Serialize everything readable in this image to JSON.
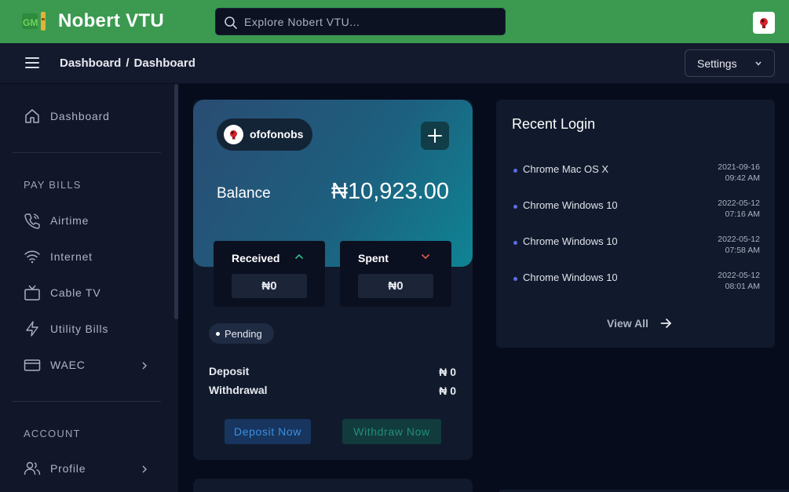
{
  "app": {
    "brand": "Nobert VTU"
  },
  "search": {
    "placeholder": "Explore Nobert VTU..."
  },
  "breadcrumb": {
    "parent": "Dashboard",
    "separator": "/",
    "current": "Dashboard"
  },
  "settings": {
    "label": "Settings"
  },
  "sidebar": {
    "dashboard": "Dashboard",
    "pay_bills_heading": "PAY BILLS",
    "items": [
      {
        "label": "Airtime",
        "icon": "phone-icon"
      },
      {
        "label": "Internet",
        "icon": "wifi-icon"
      },
      {
        "label": "Cable TV",
        "icon": "tv-icon"
      },
      {
        "label": "Utility Bills",
        "icon": "bolt-icon"
      },
      {
        "label": "WAEC",
        "icon": "card-icon"
      }
    ],
    "account_heading": "ACCOUNT",
    "profile": "Profile"
  },
  "wallet": {
    "username": "ofofonobs",
    "balance_label": "Balance",
    "balance_value": "₦10,923.00",
    "received_label": "Received",
    "received_value": "₦0",
    "spent_label": "Spent",
    "spent_value": "₦0",
    "status_badge": "Pending",
    "deposit_label": "Deposit",
    "deposit_value": "₦ 0",
    "withdrawal_label": "Withdrawal",
    "withdrawal_value": "₦ 0",
    "deposit_button": "Deposit Now",
    "withdraw_button": "Withdraw Now"
  },
  "recent_login": {
    "title": "Recent Login",
    "entries": [
      {
        "device": "Chrome Mac OS X",
        "date": "2021-09-16",
        "time": "09:42 AM"
      },
      {
        "device": "Chrome Windows 10",
        "date": "2022-05-12",
        "time": "07:16 AM"
      },
      {
        "device": "Chrome Windows 10",
        "date": "2022-05-12",
        "time": "07:58 AM"
      },
      {
        "device": "Chrome Windows 10",
        "date": "2022-05-12",
        "time": "08:01 AM"
      }
    ],
    "view_all": "View All"
  },
  "colors": {
    "topbar": "#3b9a50",
    "accent_received": "#2fbf8f",
    "accent_spent": "#e05a4f",
    "dot": "#5b6ee6"
  }
}
